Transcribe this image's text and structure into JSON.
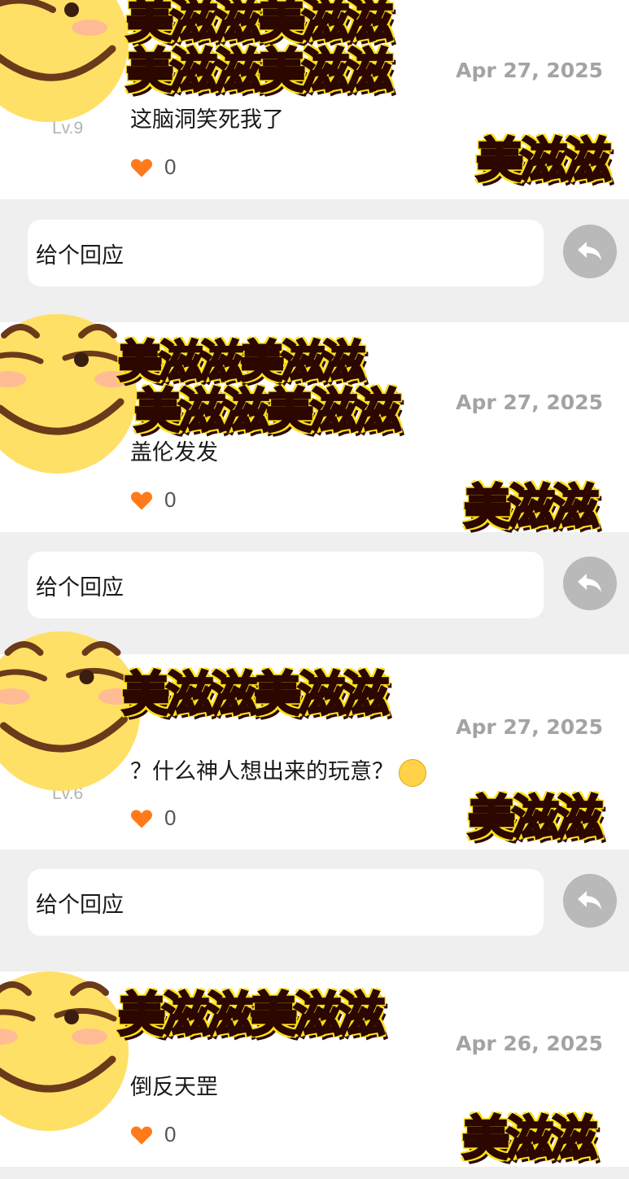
{
  "comments": [
    {
      "level": "Lv.9",
      "date": "Apr 27, 2025",
      "text": "这脑洞笑死我了",
      "likes": "0"
    },
    {
      "level": "",
      "date": "Apr 27, 2025",
      "text": "盖伦发发",
      "likes": "0"
    },
    {
      "level": "Lv.6",
      "date": "Apr 27, 2025",
      "text": "？什么神人想出来的玩意？",
      "likes": "0",
      "emoji": "speechless-face-emoji"
    },
    {
      "level": "",
      "date": "Apr 26, 2025",
      "text": "倒反天罡",
      "likes": "0"
    }
  ],
  "reply": {
    "placeholder": "给个回应",
    "icon": "reply-arrow-icon"
  },
  "stickers": {
    "caption": "美滋滋",
    "double": "美滋滋美滋滋",
    "face_icon": "smirking-face-sticker"
  },
  "colors": {
    "accent": "#ff7a1a",
    "heart": "#ff7a1a",
    "reply_button": "#b9b9b9",
    "background": "#efefef"
  }
}
